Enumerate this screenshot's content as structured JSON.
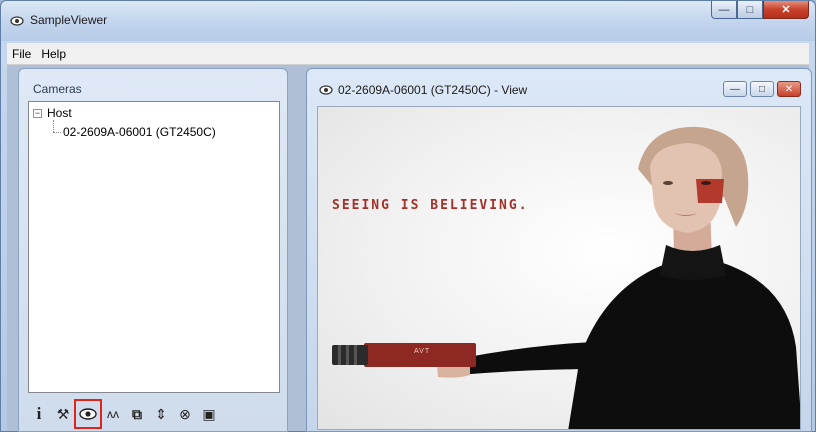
{
  "window": {
    "title": "SampleViewer",
    "minimize_glyph": "—",
    "maximize_glyph": "□",
    "close_glyph": "✕"
  },
  "menu": [
    "File",
    "Help"
  ],
  "cameras_panel": {
    "title": "Cameras",
    "tree": {
      "host_label": "Host",
      "expander": "−",
      "camera_label": "02-2609A-06001 (GT2450C)"
    },
    "toolbar": [
      {
        "name": "info-icon",
        "glyph": "i"
      },
      {
        "name": "wrench-icon",
        "glyph": "⚒"
      },
      {
        "name": "eye-icon",
        "glyph": "◉",
        "selected": true
      },
      {
        "name": "waveform-icon",
        "glyph": "ʌʌ"
      },
      {
        "name": "camera-link-icon",
        "glyph": "⧉"
      },
      {
        "name": "io-icon",
        "glyph": "⇕"
      },
      {
        "name": "target-icon",
        "glyph": "⊗"
      },
      {
        "name": "save-icon",
        "glyph": "▣"
      }
    ]
  },
  "view_window": {
    "title": "02-2609A-06001 (GT2450C) - View",
    "min_glyph": "—",
    "max_glyph": "□",
    "close_glyph": "✕",
    "image_text": "SEEING IS BELIEVING.",
    "camera_brand": "AVT"
  },
  "colors": {
    "accent_red": "#e0241b",
    "slogan_red": "#a3312a"
  }
}
